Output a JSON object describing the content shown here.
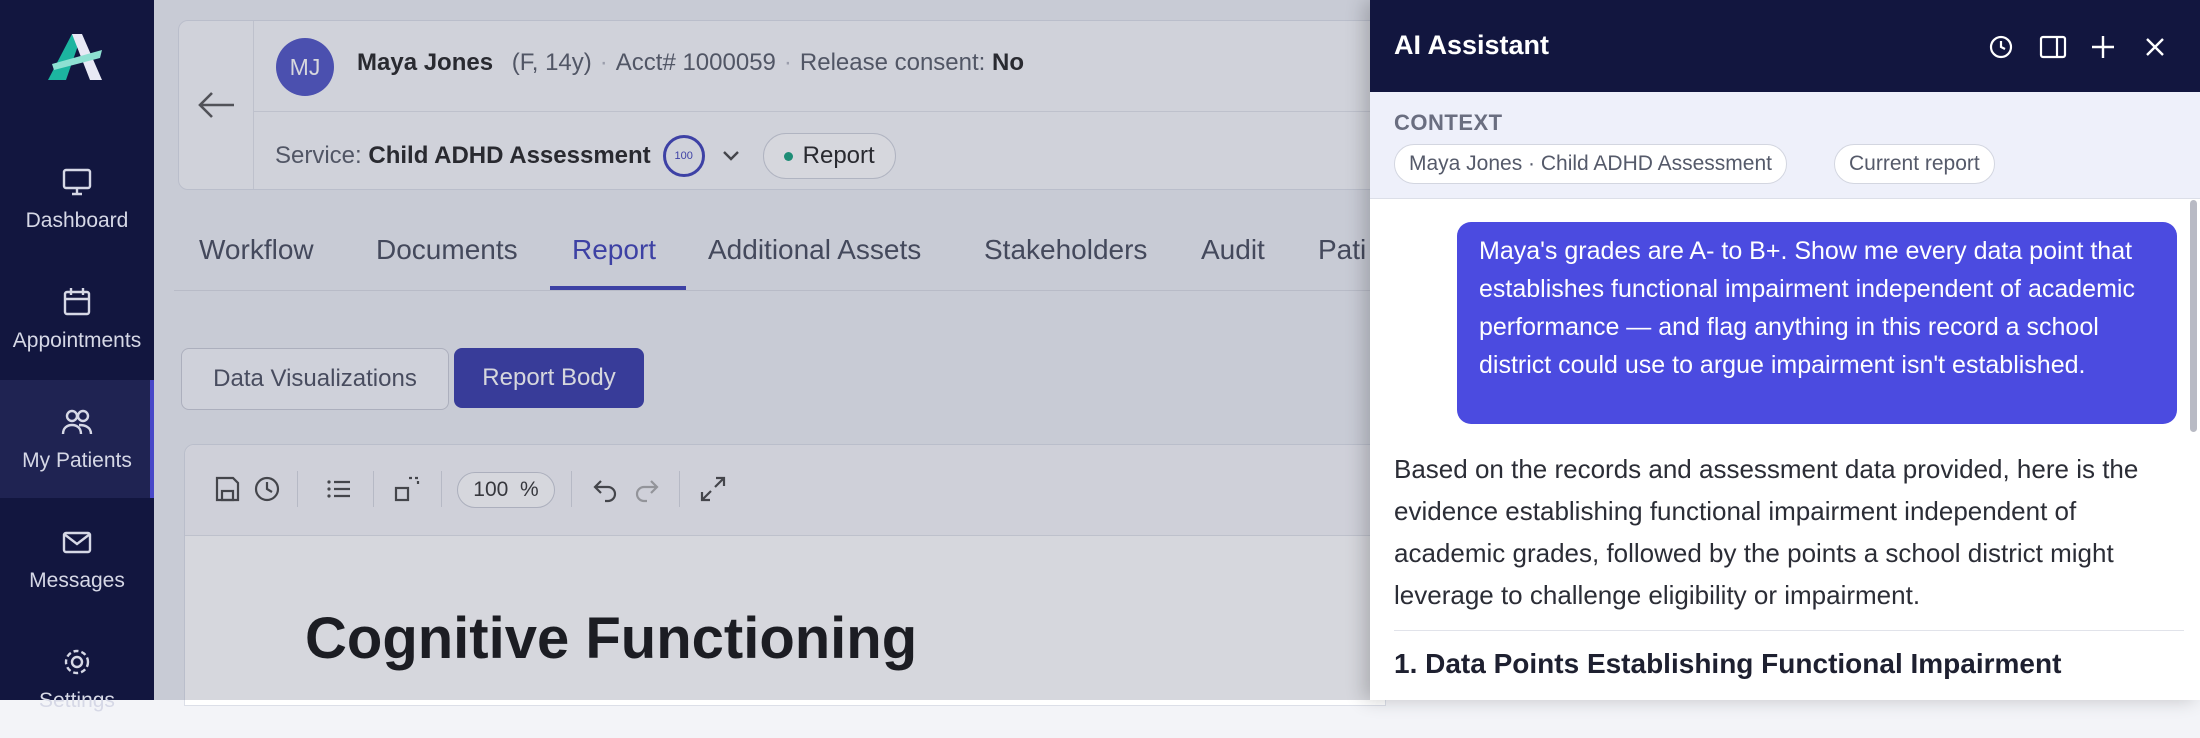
{
  "nav": {
    "items": [
      {
        "label": "Dashboard",
        "icon": "monitor-icon"
      },
      {
        "label": "Appointments",
        "icon": "calendar-icon"
      },
      {
        "label": "My Patients",
        "icon": "patients-icon"
      },
      {
        "label": "Messages",
        "icon": "mail-icon"
      },
      {
        "label": "Settings",
        "icon": "gear-icon"
      }
    ]
  },
  "patient": {
    "initials": "MJ",
    "name": "Maya Jones",
    "demographics": "(F, 14y)",
    "acct": "Acct# 1000059",
    "consent_label": "Release consent:",
    "consent_value": "No",
    "service_label": "Service:",
    "service_value": "Child ADHD Assessment",
    "score": "100",
    "status_pill": "Report"
  },
  "tabs": [
    "Workflow",
    "Documents",
    "Report",
    "Additional Assets",
    "Stakeholders",
    "Audit",
    "Pati"
  ],
  "subtabs": {
    "data_viz": "Data Visualizations",
    "report_body": "Report Body"
  },
  "editor": {
    "zoom_value": "100",
    "zoom_unit": "%",
    "heading": "Cognitive Functioning"
  },
  "assistant": {
    "title": "AI Assistant",
    "context_label": "CONTEXT",
    "chips": [
      "Maya Jones · Child ADHD Assessment",
      "Current report"
    ],
    "user_message": "Maya's grades are A- to B+. Show me every data point that establishes functional impairment independent of academic performance — and flag anything in this record a school district could use to argue impairment isn't established.",
    "answer": "Based on the records and assessment data provided, here is the evidence establishing functional impairment independent of academic grades, followed by the points a school district might leverage to challenge eligibility or impairment.",
    "section_heading": "1. Data Points Establishing Functional Impairment"
  },
  "colors": {
    "nav_bg": "#12163f",
    "accent": "#3b3fb6",
    "bubble": "#4b4be0"
  }
}
